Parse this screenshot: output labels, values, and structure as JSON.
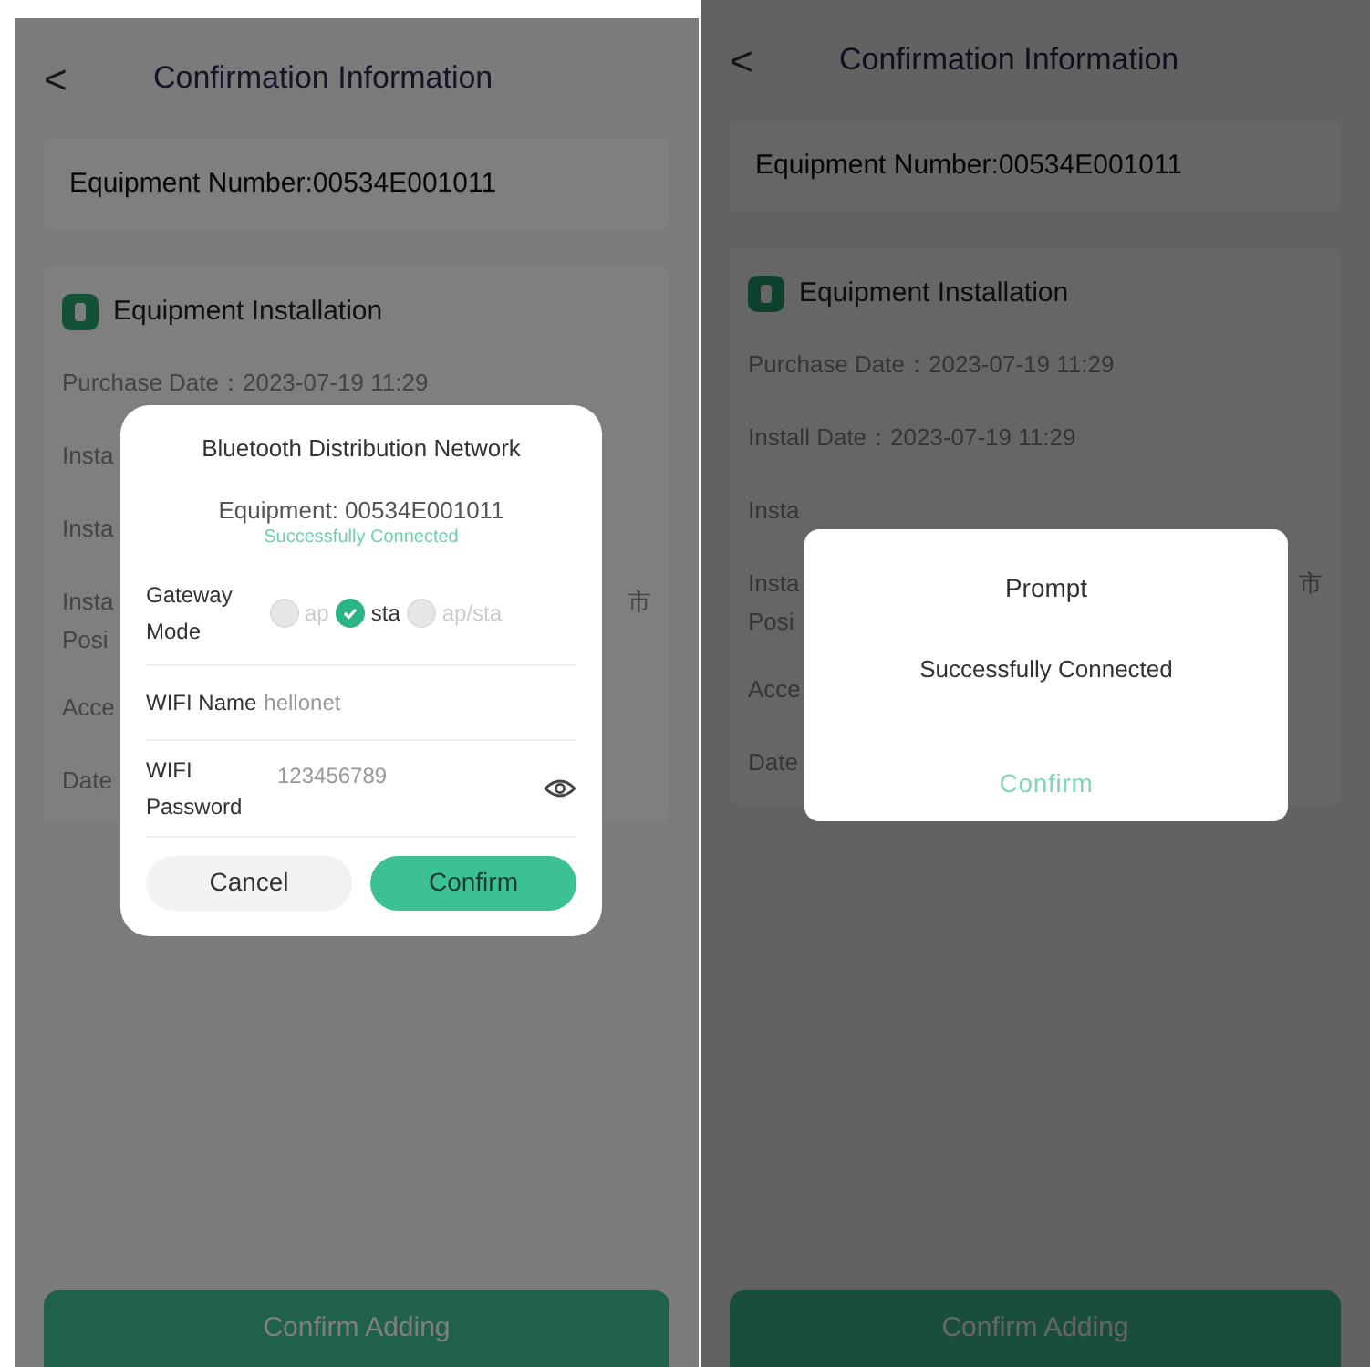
{
  "screens": [
    {
      "header": {
        "back": "<",
        "title": "Confirmation Information"
      },
      "equipment_number": "Equipment Number:00534E001011",
      "section_title": "Equipment Installation",
      "info_rows": [
        {
          "lines": [
            "Purchase Date：2023-07-19 11:29"
          ]
        },
        {
          "lines": [
            "Insta"
          ]
        },
        {
          "lines": [
            "Insta"
          ]
        },
        {
          "lines": [
            "Insta",
            "Posi"
          ],
          "trailing": "市"
        },
        {
          "lines": [
            "Acce"
          ]
        },
        {
          "lines": [
            "Date"
          ]
        }
      ],
      "bottom_button": "Confirm Adding",
      "dialog": {
        "kind": "config",
        "title": "Bluetooth Distribution Network",
        "equipment": "Equipment: 00534E001011",
        "status": "Successfully Connected",
        "gateway_mode": {
          "label": "Gateway Mode",
          "options": [
            {
              "label": "ap",
              "selected": false
            },
            {
              "label": "sta",
              "selected": true
            },
            {
              "label": "ap/sta",
              "selected": false
            }
          ]
        },
        "wifi_name": {
          "label": "WIFI Name",
          "value": "hellonet"
        },
        "wifi_password": {
          "label": "WIFI Password",
          "value": "123456789"
        },
        "buttons": [
          {
            "label": "Cancel",
            "kind": "secondary"
          },
          {
            "label": "Confirm",
            "kind": "primary"
          }
        ]
      }
    },
    {
      "header": {
        "back": "<",
        "title": "Confirmation Information"
      },
      "equipment_number": "Equipment Number:00534E001011",
      "section_title": "Equipment Installation",
      "info_rows": [
        {
          "lines": [
            "Purchase Date：2023-07-19 11:29"
          ]
        },
        {
          "lines": [
            "Install Date：2023-07-19 11:29"
          ]
        },
        {
          "lines": [
            "Insta"
          ]
        },
        {
          "lines": [
            "Insta",
            "Posi"
          ],
          "trailing": "市"
        },
        {
          "lines": [
            "Acce"
          ]
        },
        {
          "lines": [
            "Date"
          ]
        }
      ],
      "bottom_button": "Confirm Adding",
      "dialog": {
        "kind": "prompt",
        "title": "Prompt",
        "message": "Successfully Connected",
        "button": "Confirm"
      }
    }
  ]
}
